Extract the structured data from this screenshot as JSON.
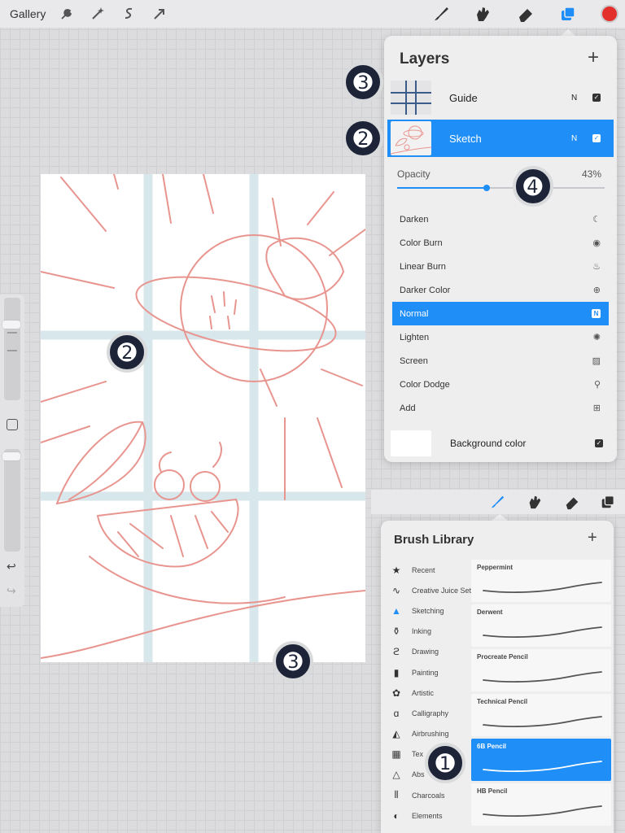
{
  "topbar": {
    "gallery_label": "Gallery",
    "left_tools": [
      "wrench-icon",
      "magic-wand-icon",
      "selection-icon",
      "transform-arrow-icon"
    ],
    "right_tools": [
      "brush-icon",
      "smudge-icon",
      "eraser-icon",
      "layers-icon"
    ],
    "active_tool": "layers-icon",
    "current_color": "#e3302c",
    "accent_color": "#1f8ef7"
  },
  "layers": {
    "title": "Layers",
    "add_label": "+",
    "items": [
      {
        "name": "Guide",
        "mode": "N",
        "visible": true,
        "selected": false
      },
      {
        "name": "Sketch",
        "mode": "N",
        "visible": true,
        "selected": true
      }
    ],
    "opacity_label": "Opacity",
    "opacity_value": "43%",
    "opacity_fraction": 0.43,
    "blend_modes": [
      {
        "label": "Darken",
        "icon": "☾"
      },
      {
        "label": "Color Burn",
        "icon": "◉"
      },
      {
        "label": "Linear Burn",
        "icon": "♨"
      },
      {
        "label": "Darker Color",
        "icon": "⊕"
      },
      {
        "label": "Normal",
        "icon": "N"
      },
      {
        "label": "Lighten",
        "icon": "✺"
      },
      {
        "label": "Screen",
        "icon": "▨"
      },
      {
        "label": "Color Dodge",
        "icon": "⚲"
      },
      {
        "label": "Add",
        "icon": "⊞"
      }
    ],
    "selected_blend": "Normal",
    "background_label": "Background color"
  },
  "brush_library": {
    "title": "Brush Library",
    "add_label": "+",
    "categories": [
      {
        "label": "Recent",
        "icon": "★"
      },
      {
        "label": "Creative Juice Set",
        "icon": "∿"
      },
      {
        "label": "Sketching",
        "icon": "▲"
      },
      {
        "label": "Inking",
        "icon": "⚱"
      },
      {
        "label": "Drawing",
        "icon": "ϩ"
      },
      {
        "label": "Painting",
        "icon": "▮"
      },
      {
        "label": "Artistic",
        "icon": "✿"
      },
      {
        "label": "Calligraphy",
        "icon": "ɑ"
      },
      {
        "label": "Airbrushing",
        "icon": "◭"
      },
      {
        "label": "Tex",
        "icon": "▦"
      },
      {
        "label": "Abs",
        "icon": "△"
      },
      {
        "label": "Charcoals",
        "icon": "⦀"
      },
      {
        "label": "Elements",
        "icon": "◐"
      }
    ],
    "active_category": "Sketching",
    "brushes": [
      {
        "name": "Peppermint",
        "selected": false
      },
      {
        "name": "Derwent",
        "selected": false
      },
      {
        "name": "Procreate Pencil",
        "selected": false
      },
      {
        "name": "Technical Pencil",
        "selected": false
      },
      {
        "name": "6B Pencil",
        "selected": true
      },
      {
        "name": "HB Pencil",
        "selected": false
      }
    ]
  },
  "callouts": [
    "➊",
    "➋",
    "➌",
    "➍"
  ]
}
